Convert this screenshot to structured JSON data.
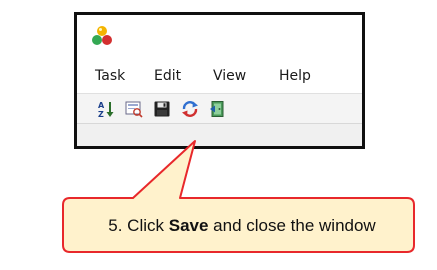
{
  "window": {
    "app_icon": "colored-spheres-icon",
    "menu": [
      "Task",
      "Edit",
      "View",
      "Help"
    ],
    "toolbar": [
      "sort-az-icon",
      "preview-icon",
      "save-icon",
      "refresh-icon",
      "exit-icon"
    ]
  },
  "callout": {
    "prefix": "5. Click ",
    "emphasis": "Save",
    "suffix": " and close the window"
  },
  "colors": {
    "callout_border": "#e8282b",
    "callout_fill": "#fff2cc",
    "window_border": "#101010"
  }
}
